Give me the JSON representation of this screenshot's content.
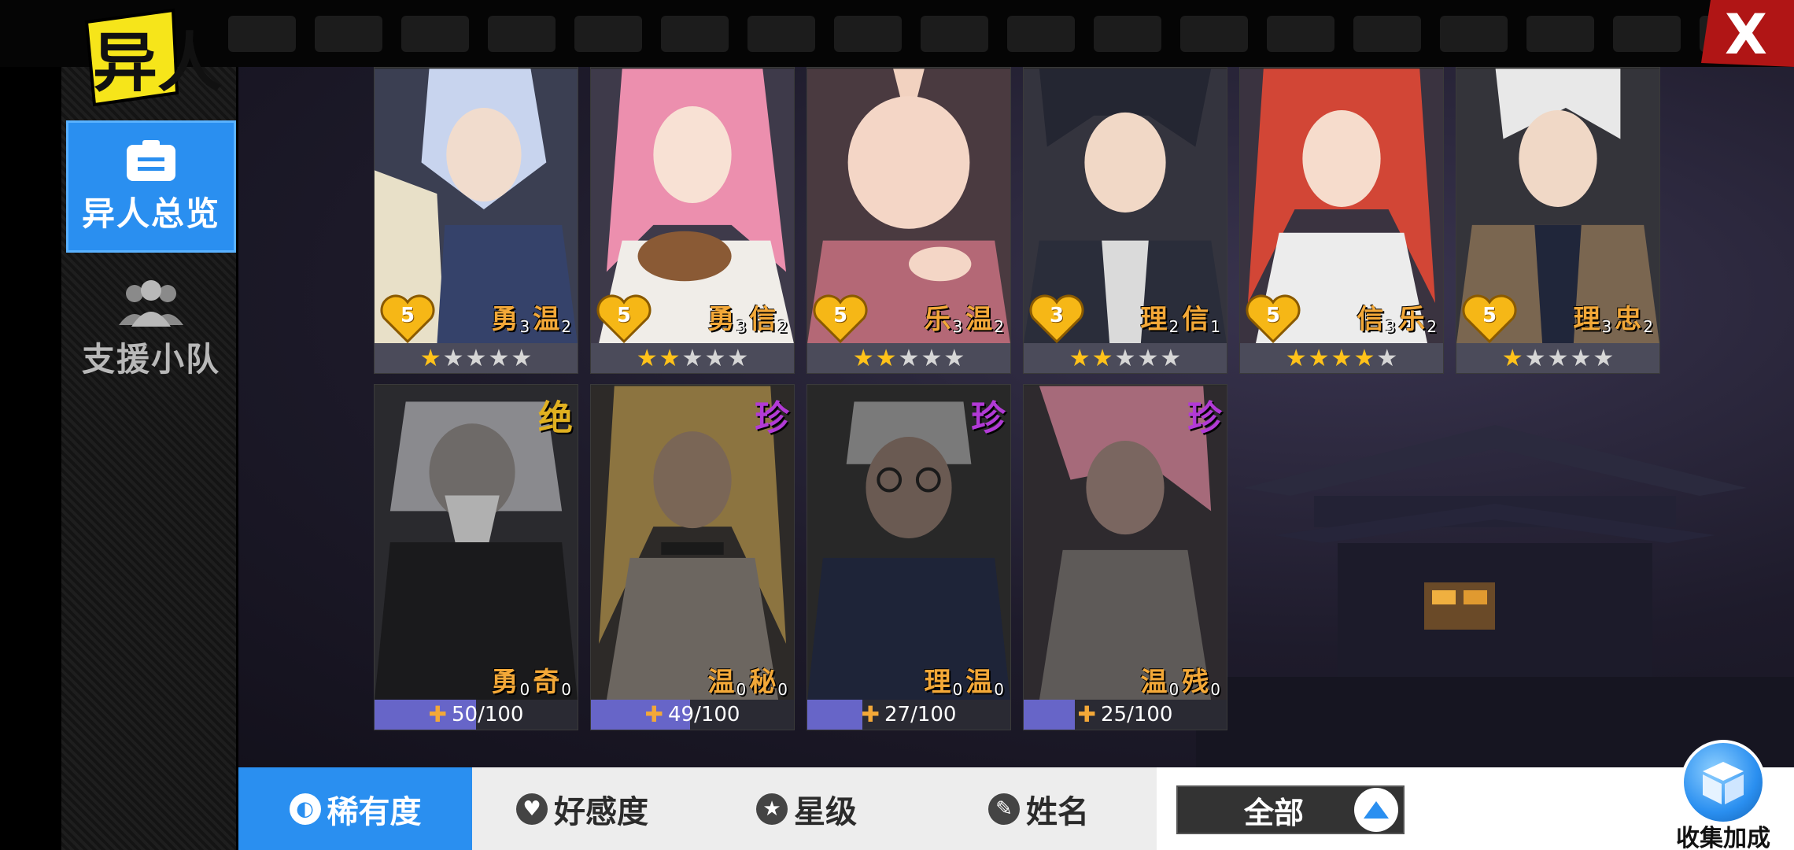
{
  "header": {
    "logo_text": "异人",
    "close_label": "X"
  },
  "sidebar": {
    "items": [
      {
        "label": "异人总览",
        "icon": "document-icon",
        "active": true
      },
      {
        "label": "支援小队",
        "icon": "team-icon",
        "active": false
      }
    ]
  },
  "cards_row1": [
    {
      "heart": "5",
      "t1": "勇",
      "n1": "3",
      "t2": "温",
      "n2": "2",
      "stars": 1,
      "max_stars": 5
    },
    {
      "heart": "5",
      "t1": "勇",
      "n1": "3",
      "t2": "信",
      "n2": "2",
      "stars": 2,
      "max_stars": 5
    },
    {
      "heart": "5",
      "t1": "乐",
      "n1": "3",
      "t2": "温",
      "n2": "2",
      "stars": 2,
      "max_stars": 5
    },
    {
      "heart": "3",
      "t1": "理",
      "n1": "2",
      "t2": "信",
      "n2": "1",
      "stars": 2,
      "max_stars": 5
    },
    {
      "heart": "5",
      "t1": "信",
      "n1": "3",
      "t2": "乐",
      "n2": "2",
      "stars": 4,
      "max_stars": 5
    },
    {
      "heart": "5",
      "t1": "理",
      "n1": "3",
      "t2": "忠",
      "n2": "2",
      "stars": 1,
      "max_stars": 5
    }
  ],
  "cards_row2": [
    {
      "rarity": "绝",
      "t1": "勇",
      "n1": "0",
      "t2": "奇",
      "n2": "0",
      "progress_text": "50/100",
      "progress": 0.5
    },
    {
      "rarity": "珍",
      "t1": "温",
      "n1": "0",
      "t2": "秘",
      "n2": "0",
      "progress_text": "49/100",
      "progress": 0.49
    },
    {
      "rarity": "珍",
      "t1": "理",
      "n1": "0",
      "t2": "温",
      "n2": "0",
      "progress_text": "27/100",
      "progress": 0.27
    },
    {
      "rarity": "珍",
      "t1": "温",
      "n1": "0",
      "t2": "残",
      "n2": "0",
      "progress_text": "25/100",
      "progress": 0.25
    }
  ],
  "sort_tabs": [
    {
      "label": "稀有度",
      "icon": "rarity-icon",
      "active": true
    },
    {
      "label": "好感度",
      "icon": "heart-icon",
      "active": false
    },
    {
      "label": "星级",
      "icon": "star-icon",
      "active": false
    },
    {
      "label": "姓名",
      "icon": "pen-icon",
      "active": false
    }
  ],
  "filter": {
    "label": "全部"
  },
  "collect": {
    "label": "收集加成"
  },
  "colors": {
    "accent": "#2a8ff0",
    "gold": "#f3a838",
    "rare_purple": "#b23ad6",
    "epic_gold": "#e0b020",
    "progress": "#6765c8"
  }
}
